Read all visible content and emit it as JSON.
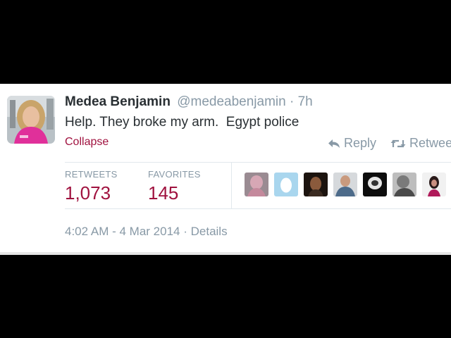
{
  "tweet": {
    "author_name": "Medea Benjamin",
    "handle": "@medeabenjamin",
    "separator": "·",
    "age": "7h",
    "text": "Help. They broke my arm.  Egypt police",
    "collapse_label": "Collapse",
    "reply_label": "Reply",
    "retweet_label": "Retweet"
  },
  "stats": {
    "retweets_label": "RETWEETS",
    "retweets_value": "1,073",
    "favorites_label": "FAVORITES",
    "favorites_value": "145"
  },
  "footer": {
    "timestamp": "4:02 AM - 4 Mar 2014",
    "separator": "·",
    "details_label": "Details"
  },
  "favoriters": [
    {
      "icon": "user-avatar"
    },
    {
      "icon": "default-egg-avatar"
    },
    {
      "icon": "user-avatar"
    },
    {
      "icon": "user-avatar"
    },
    {
      "icon": "user-avatar"
    },
    {
      "icon": "user-avatar"
    },
    {
      "icon": "user-avatar"
    }
  ],
  "colors": {
    "accent": "#a0123f",
    "muted": "#8899a6",
    "text": "#292f33",
    "egg_avatar_bg": "#a9d6ee"
  }
}
